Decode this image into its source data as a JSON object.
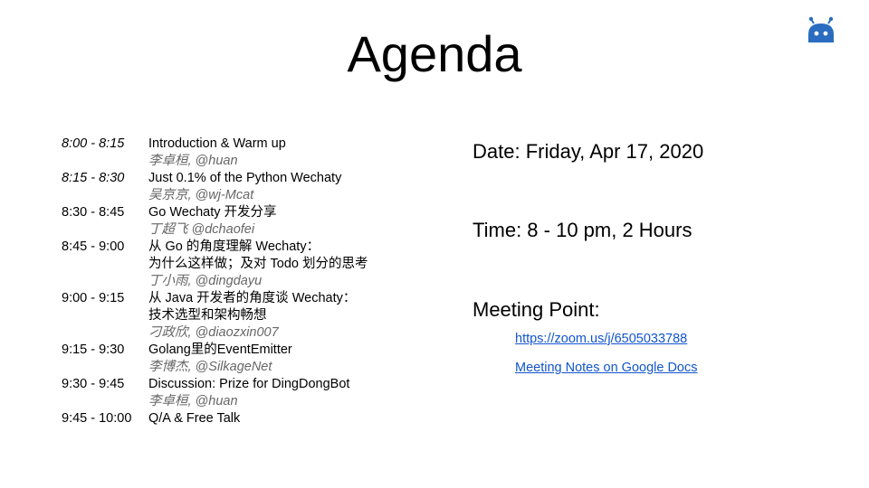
{
  "title": "Agenda",
  "logo": {
    "icon": "robot-icon",
    "color": "#2a6cbf"
  },
  "agenda": [
    {
      "time": "8:00 - 8:15",
      "time_italic": true,
      "lines": [
        "Introduction & Warm up"
      ],
      "speaker": "李卓桓, @huan"
    },
    {
      "time": "8:15 - 8:30",
      "time_italic": true,
      "lines": [
        "Just 0.1% of the Python Wechaty"
      ],
      "speaker": "吴京京, @wj-Mcat"
    },
    {
      "time": "8:30 - 8:45",
      "time_italic": false,
      "lines": [
        "Go Wechaty 开发分享"
      ],
      "speaker": "丁超飞 @dchaofei"
    },
    {
      "time": "8:45 - 9:00",
      "time_italic": false,
      "lines": [
        "从 Go 的角度理解 Wechaty：",
        "为什么这样做；及对 Todo 划分的思考"
      ],
      "speaker": "丁小雨, @dingdayu"
    },
    {
      "time": "9:00 - 9:15",
      "time_italic": false,
      "lines": [
        "从 Java 开发者的角度谈 Wechaty：",
        "技术选型和架构畅想"
      ],
      "speaker": "刁政欣, @diaozxin007"
    },
    {
      "time": "9:15 - 9:30",
      "time_italic": false,
      "lines": [
        "Golang里的EventEmitter"
      ],
      "speaker": "李博杰, @SilkageNet"
    },
    {
      "time": "9:30 - 9:45",
      "time_italic": false,
      "lines": [
        "Discussion: Prize for DingDongBot"
      ],
      "speaker": "李卓桓, @huan"
    },
    {
      "time": "9:45 - 10:00",
      "time_italic": false,
      "lines": [
        "Q/A & Free Talk"
      ],
      "speaker": ""
    }
  ],
  "info": {
    "date": "Date: Friday, Apr 17, 2020",
    "time": "Time: 8 - 10 pm, 2 Hours",
    "meeting_point": "Meeting Point:",
    "zoom_link": "https://zoom.us/j/6505033788",
    "notes_link": "Meeting Notes on Google Docs"
  },
  "colors": {
    "link": "#1155cc",
    "speaker": "#666666"
  }
}
